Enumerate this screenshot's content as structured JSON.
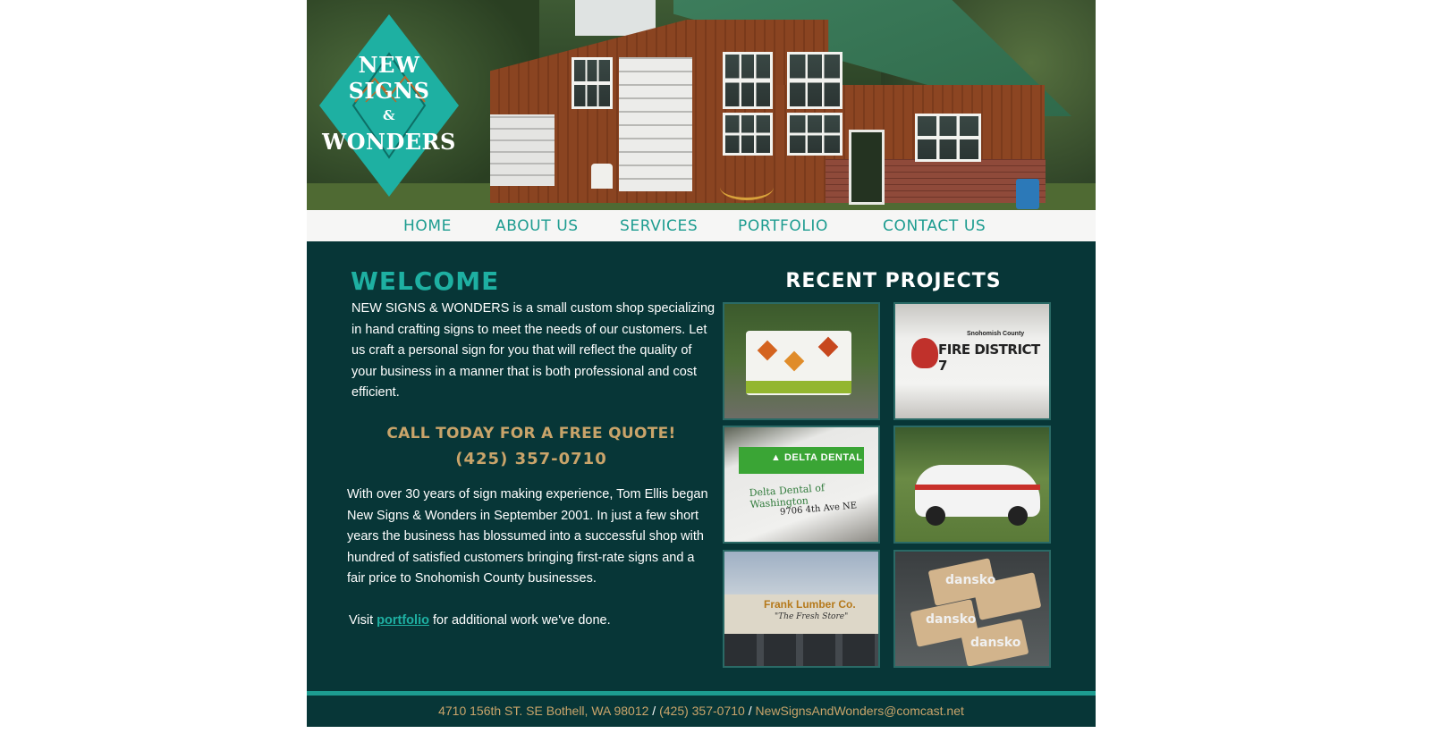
{
  "logo": {
    "line1": "NEW SIGNS",
    "amp": "&",
    "line2": "WONDERS",
    "color": "#1eb0a2"
  },
  "nav": {
    "items": [
      {
        "label": "HOME"
      },
      {
        "label": "ABOUT US"
      },
      {
        "label": "SERVICES"
      },
      {
        "label": "PORTFOLIO"
      },
      {
        "label": "CONTACT US"
      }
    ]
  },
  "main": {
    "welcome_title": "WELCOME",
    "intro": " NEW SIGNS & WONDERS is a small custom shop specializing in hand crafting signs to meet the needs of our customers. Let us craft a personal sign for you that will reflect the quality of your business in a manner that is both professional and cost efficient.",
    "cta_line1": "CALL TODAY FOR A FREE QUOTE!",
    "cta_line2": "(425) 357-0710",
    "about": "With over 30 years of sign making experience, Tom Ellis began New Signs & Wonders in September 2001. In just a few short years the business has blossumed into a successful shop with hundred of satisfied customers bringing first-rate signs and a fair price to Snohomish County businesses.",
    "visit_prefix": "Visit ",
    "visit_link": "portfolio",
    "visit_suffix": " for additional work we've done."
  },
  "recent": {
    "title": "RECENT PROJECTS",
    "thumb_text": {
      "fire_county": "Snohomish County",
      "fire_district": "FIRE DISTRICT 7",
      "delta_logo": "▲ DELTA DENTAL",
      "delta_sub": "Delta Dental of Washington",
      "delta_addr": "9706 4th Ave NE",
      "lumber": "Frank Lumber Co.",
      "lumber_sub": "\"The Fresh Store\"",
      "dansko_1": "dansko",
      "dansko_2": "dansko",
      "dansko_3": "dansko"
    }
  },
  "footer": {
    "address": "4710 156th ST. SE Bothell, WA 98012",
    "sep1": " / ",
    "phone": "(425) 357-0710",
    "sep2": " / ",
    "email": "NewSignsAndWonders@comcast.net"
  },
  "colors": {
    "teal_accent": "#1eb0a2",
    "dark_teal_bg": "#073637",
    "gold": "#c9a46a",
    "nav_bg": "#f6f6f5"
  }
}
